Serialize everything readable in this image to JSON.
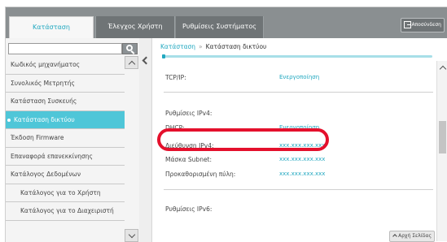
{
  "tabs": {
    "status": "Κατάσταση",
    "user_control": "Έλεγχος Χρήστη",
    "system_settings": "Ρυθμίσεις Συστήματος"
  },
  "logout_label": "Αποσύνδεση",
  "sidebar": {
    "items": [
      {
        "label": "Κωδικός μηχανήματος"
      },
      {
        "label": "Συνολικός Μετρητής"
      },
      {
        "label": "Κατάσταση Συσκευής"
      },
      {
        "label": "Κατάσταση δικτύου"
      },
      {
        "label": "Έκδοση Firmware"
      },
      {
        "label": "Επαναφορά επανεκκίνησης"
      },
      {
        "label": "Κατάλογος Δεδομένων"
      },
      {
        "label": "Κατάλογος για το Χρήστη"
      },
      {
        "label": "Κατάλογος για το Διαχειριστή"
      }
    ]
  },
  "breadcrumb": {
    "link": "Κατάσταση",
    "separator": "»",
    "current": "Κατάσταση δικτύου"
  },
  "rows": {
    "tcpip": {
      "label": "TCP/IP:",
      "value": "Ενεργοποίηση"
    },
    "ipv4_settings": {
      "label": "Ρυθμίσεις IPv4:"
    },
    "dhcp": {
      "label": "DHCP:",
      "value": "Ενεργοποίηση"
    },
    "ipv4_address": {
      "label": "Διεύθυνση IPv4:",
      "value": "xxx.xxx.xxx.xxx"
    },
    "subnet_mask": {
      "label": "Μάσκα Subnet:",
      "value": "xxx.xxx.xxx.xxx"
    },
    "default_gateway": {
      "label": "Προκαθορισμένη πύλη:",
      "value": "xxx.xxx.xxx.xxx"
    },
    "ipv6_settings": {
      "label": "Ρυθμίσεις IPv6:"
    }
  },
  "top_button": "Αρχή Σελίδας",
  "colors": {
    "accent": "#22a8c0",
    "active_item": "#4fc6d8",
    "highlight": "#e4102c",
    "tabbar": "#8a8f91"
  }
}
